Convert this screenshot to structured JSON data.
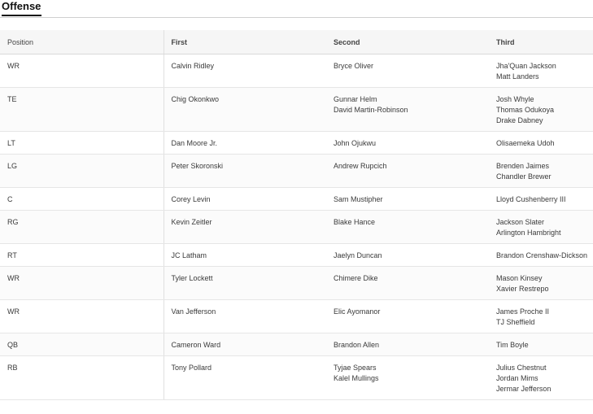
{
  "section": {
    "title": "Offense"
  },
  "table": {
    "headers": {
      "position": "Position",
      "first": "First",
      "second": "Second",
      "third": "Third"
    },
    "rows": [
      {
        "position": "WR",
        "first": [
          "Calvin Ridley"
        ],
        "second": [
          "Bryce Oliver"
        ],
        "third": [
          "Jha'Quan Jackson",
          "Matt Landers"
        ]
      },
      {
        "position": "TE",
        "first": [
          "Chig Okonkwo"
        ],
        "second": [
          "Gunnar Helm",
          "David Martin-Robinson"
        ],
        "third": [
          "Josh Whyle",
          "Thomas Odukoya",
          "Drake Dabney"
        ]
      },
      {
        "position": "LT",
        "first": [
          "Dan Moore Jr."
        ],
        "second": [
          "John Ojukwu"
        ],
        "third": [
          "Olisaemeka Udoh"
        ]
      },
      {
        "position": "LG",
        "first": [
          "Peter Skoronski"
        ],
        "second": [
          "Andrew Rupcich"
        ],
        "third": [
          "Brenden Jaimes",
          "Chandler Brewer"
        ]
      },
      {
        "position": "C",
        "first": [
          "Corey Levin"
        ],
        "second": [
          "Sam Mustipher"
        ],
        "third": [
          "Lloyd Cushenberry III"
        ]
      },
      {
        "position": "RG",
        "first": [
          "Kevin Zeitler"
        ],
        "second": [
          "Blake Hance"
        ],
        "third": [
          "Jackson Slater",
          "Arlington Hambright"
        ]
      },
      {
        "position": "RT",
        "first": [
          "JC Latham"
        ],
        "second": [
          "Jaelyn Duncan"
        ],
        "third": [
          "Brandon Crenshaw-Dickson"
        ]
      },
      {
        "position": "WR",
        "first": [
          "Tyler Lockett"
        ],
        "second": [
          "Chimere Dike"
        ],
        "third": [
          "Mason Kinsey",
          "Xavier Restrepo"
        ]
      },
      {
        "position": "WR",
        "first": [
          "Van Jefferson"
        ],
        "second": [
          "Elic Ayomanor"
        ],
        "third": [
          "James Proche II",
          "TJ Sheffield"
        ]
      },
      {
        "position": "QB",
        "first": [
          "Cameron Ward"
        ],
        "second": [
          "Brandon Allen"
        ],
        "third": [
          "Tim Boyle"
        ]
      },
      {
        "position": "RB",
        "first": [
          "Tony Pollard"
        ],
        "second": [
          "Tyjae Spears",
          "Kalel Mullings"
        ],
        "third": [
          "Julius Chestnut",
          "Jordan Mims",
          "Jermar Jefferson"
        ]
      }
    ]
  }
}
